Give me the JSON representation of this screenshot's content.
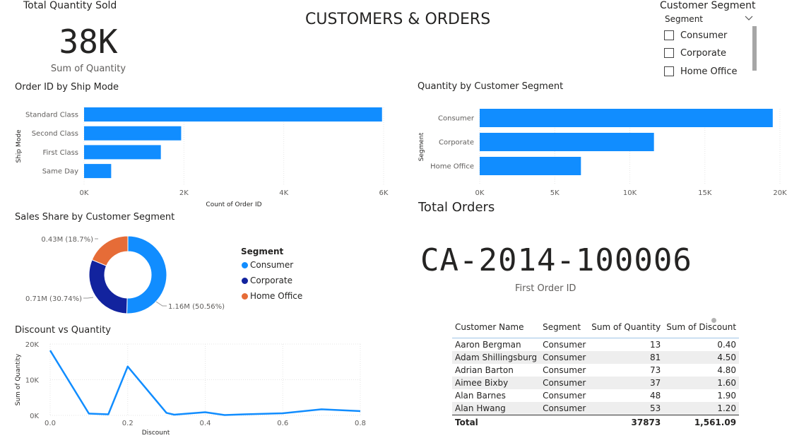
{
  "report_title": "CUSTOMERS & ORDERS",
  "kpi_quantity": {
    "title": "Total Quantity Sold",
    "value": "38K",
    "label": "Sum of Quantity"
  },
  "kpi_orders": {
    "title": "Total Orders",
    "value": "CA-2014-100006",
    "label": "First Order ID"
  },
  "slicer": {
    "title": "Customer Segment",
    "field": "Segment",
    "options": [
      "Consumer",
      "Corporate",
      "Home Office"
    ]
  },
  "colors": {
    "bar": "#118DFF",
    "consumer": "#118DFF",
    "corporate": "#12239E",
    "home_office": "#E66C37",
    "text": "#252423"
  },
  "chart_data": [
    {
      "type": "bar",
      "title": "Order ID by Ship Mode",
      "categories": [
        "Standard Class",
        "Second Class",
        "First Class",
        "Same Day"
      ],
      "values": [
        5968,
        1945,
        1538,
        543
      ],
      "xlabel": "Count of Order ID",
      "ylabel": "Ship Mode",
      "xlim": [
        0,
        6000
      ],
      "ticks": [
        "0K",
        "2K",
        "4K",
        "6K"
      ]
    },
    {
      "type": "bar",
      "title": "Quantity by Customer Segment",
      "categories": [
        "Consumer",
        "Corporate",
        "Home Office"
      ],
      "values": [
        19521,
        11608,
        6744
      ],
      "ylabel": "Segment",
      "xlim": [
        0,
        20000
      ],
      "ticks": [
        "0K",
        "5K",
        "10K",
        "15K",
        "20K"
      ]
    },
    {
      "type": "pie",
      "title": "Sales Share by Customer Segment",
      "legend_title": "Segment",
      "categories": [
        "Consumer",
        "Corporate",
        "Home Office"
      ],
      "values": [
        1.16,
        0.71,
        0.43
      ],
      "labels": [
        "1.16M (50.56%)",
        "0.71M (30.74%)",
        "0.43M (18.7%)"
      ]
    },
    {
      "type": "line",
      "title": "Discount vs Quantity",
      "x": [
        0.0,
        0.1,
        0.15,
        0.2,
        0.3,
        0.32,
        0.4,
        0.45,
        0.5,
        0.6,
        0.7,
        0.8
      ],
      "y": [
        18200,
        500,
        300,
        13700,
        700,
        200,
        900,
        100,
        300,
        600,
        1700,
        1200
      ],
      "xlabel": "Discount",
      "ylabel": "Sum of Quantity",
      "xlim": [
        0,
        0.8
      ],
      "ylim": [
        0,
        20000
      ],
      "xticks": [
        "0.0",
        "0.2",
        "0.4",
        "0.6",
        "0.8"
      ],
      "yticks": [
        "0K",
        "10K",
        "20K"
      ]
    }
  ],
  "table": {
    "columns": [
      "Customer Name",
      "Segment",
      "Sum of Quantity",
      "Sum of Discount"
    ],
    "rows": [
      [
        "Aaron Bergman",
        "Consumer",
        "13",
        "0.40"
      ],
      [
        "Adam Shillingsburg",
        "Consumer",
        "81",
        "4.50"
      ],
      [
        "Adrian Barton",
        "Consumer",
        "73",
        "4.80"
      ],
      [
        "Aimee Bixby",
        "Consumer",
        "37",
        "1.60"
      ],
      [
        "Alan Barnes",
        "Consumer",
        "48",
        "1.90"
      ],
      [
        "Alan Hwang",
        "Consumer",
        "53",
        "1.20"
      ]
    ],
    "total": [
      "Total",
      "",
      "37873",
      "1,561.09"
    ]
  }
}
